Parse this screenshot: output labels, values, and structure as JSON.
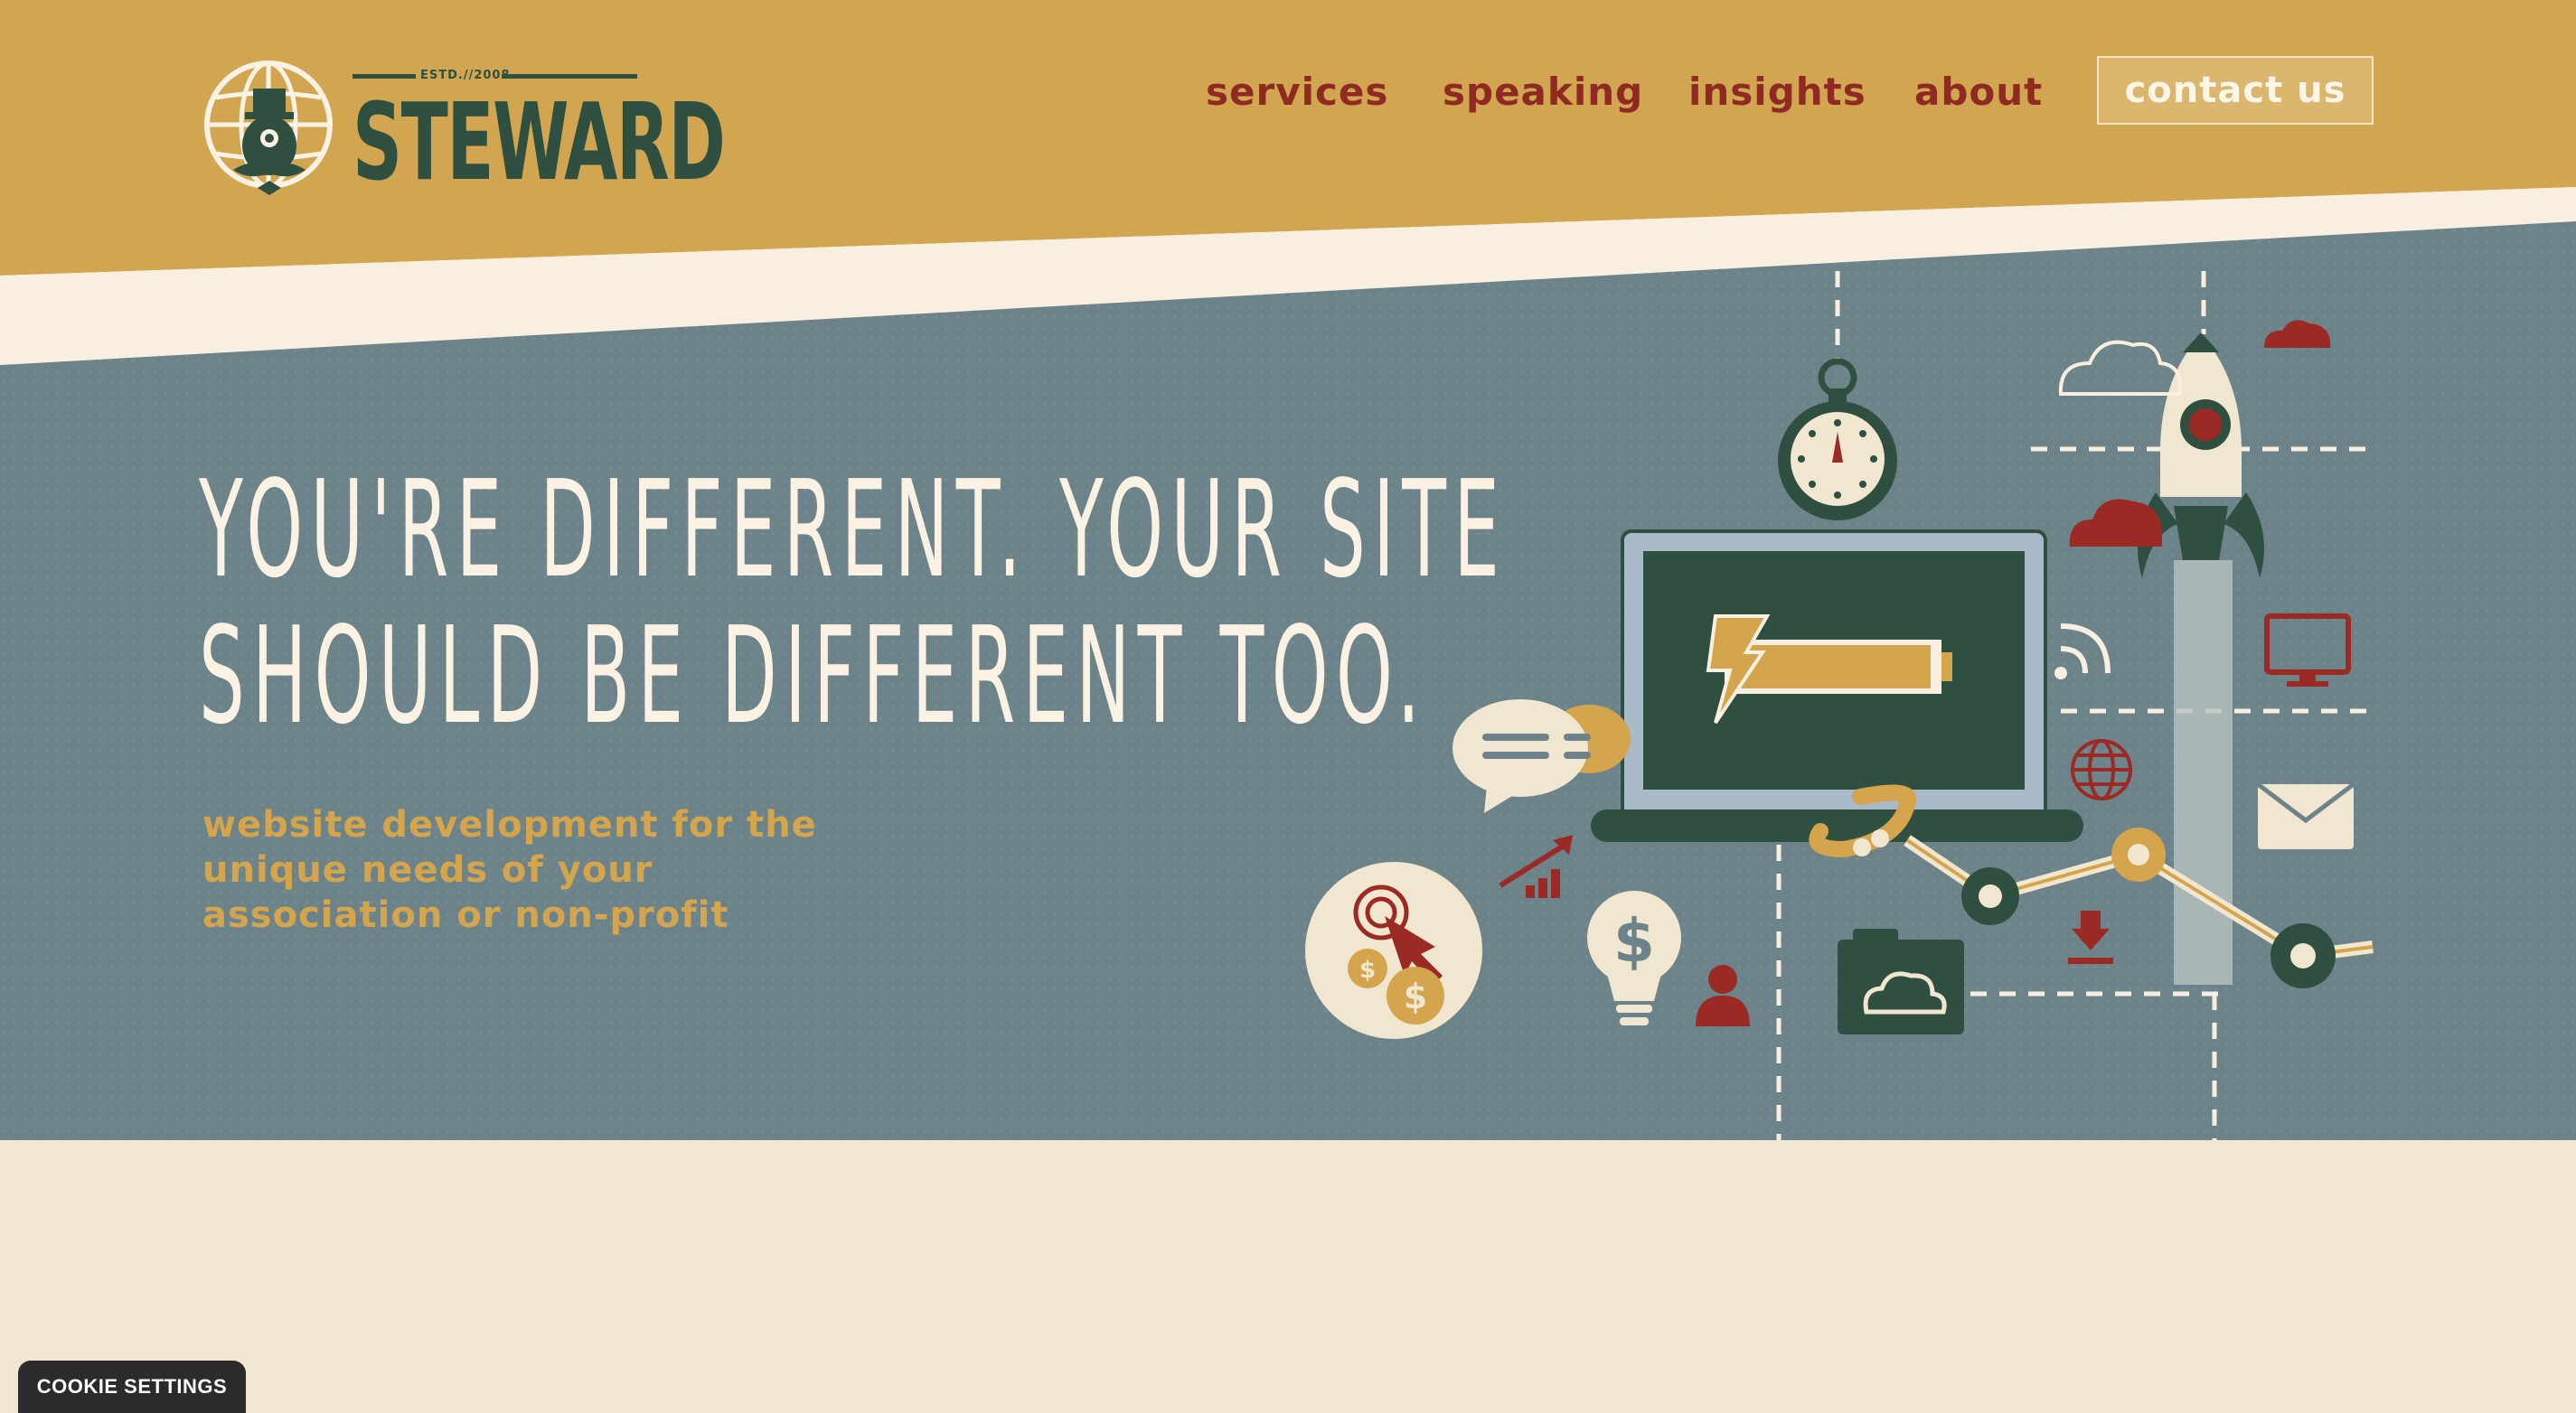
{
  "brand": {
    "name": "STEWARD",
    "estd": "ESTD.//2008"
  },
  "nav": {
    "items": [
      {
        "label": "services"
      },
      {
        "label": "speaking"
      },
      {
        "label": "insights"
      },
      {
        "label": "about"
      }
    ],
    "contact_label": "contact us"
  },
  "hero": {
    "headline_line1": "YOU'RE DIFFERENT. YOUR SITE",
    "headline_line2": "SHOULD BE DIFFERENT TOO.",
    "sub_line1": "website development for the",
    "sub_line2": "unique needs of your",
    "sub_line3": "association or non-profit"
  },
  "cookie": {
    "label": "COOKIE SETTINGS"
  },
  "colors": {
    "header_bg": "#d2a650",
    "hero_bg": "#6c838a",
    "cream_band": "#f8efe1",
    "page_bg": "#f1e6cf",
    "nav_text": "#8f2a23",
    "dark_green": "#2f4f40",
    "gold": "#d4a54d",
    "red": "#9b2a24"
  },
  "icons": [
    "globe-icon",
    "stopwatch-icon",
    "laptop-icon",
    "battery-icon",
    "rocket-icon",
    "cloud-icon",
    "chat-bubble-icon",
    "target-click-icon",
    "lightbulb-dollar-icon",
    "user-icon",
    "folder-cloud-icon",
    "download-icon",
    "monitor-icon",
    "envelope-icon",
    "wifi-icon",
    "chart-up-icon"
  ]
}
